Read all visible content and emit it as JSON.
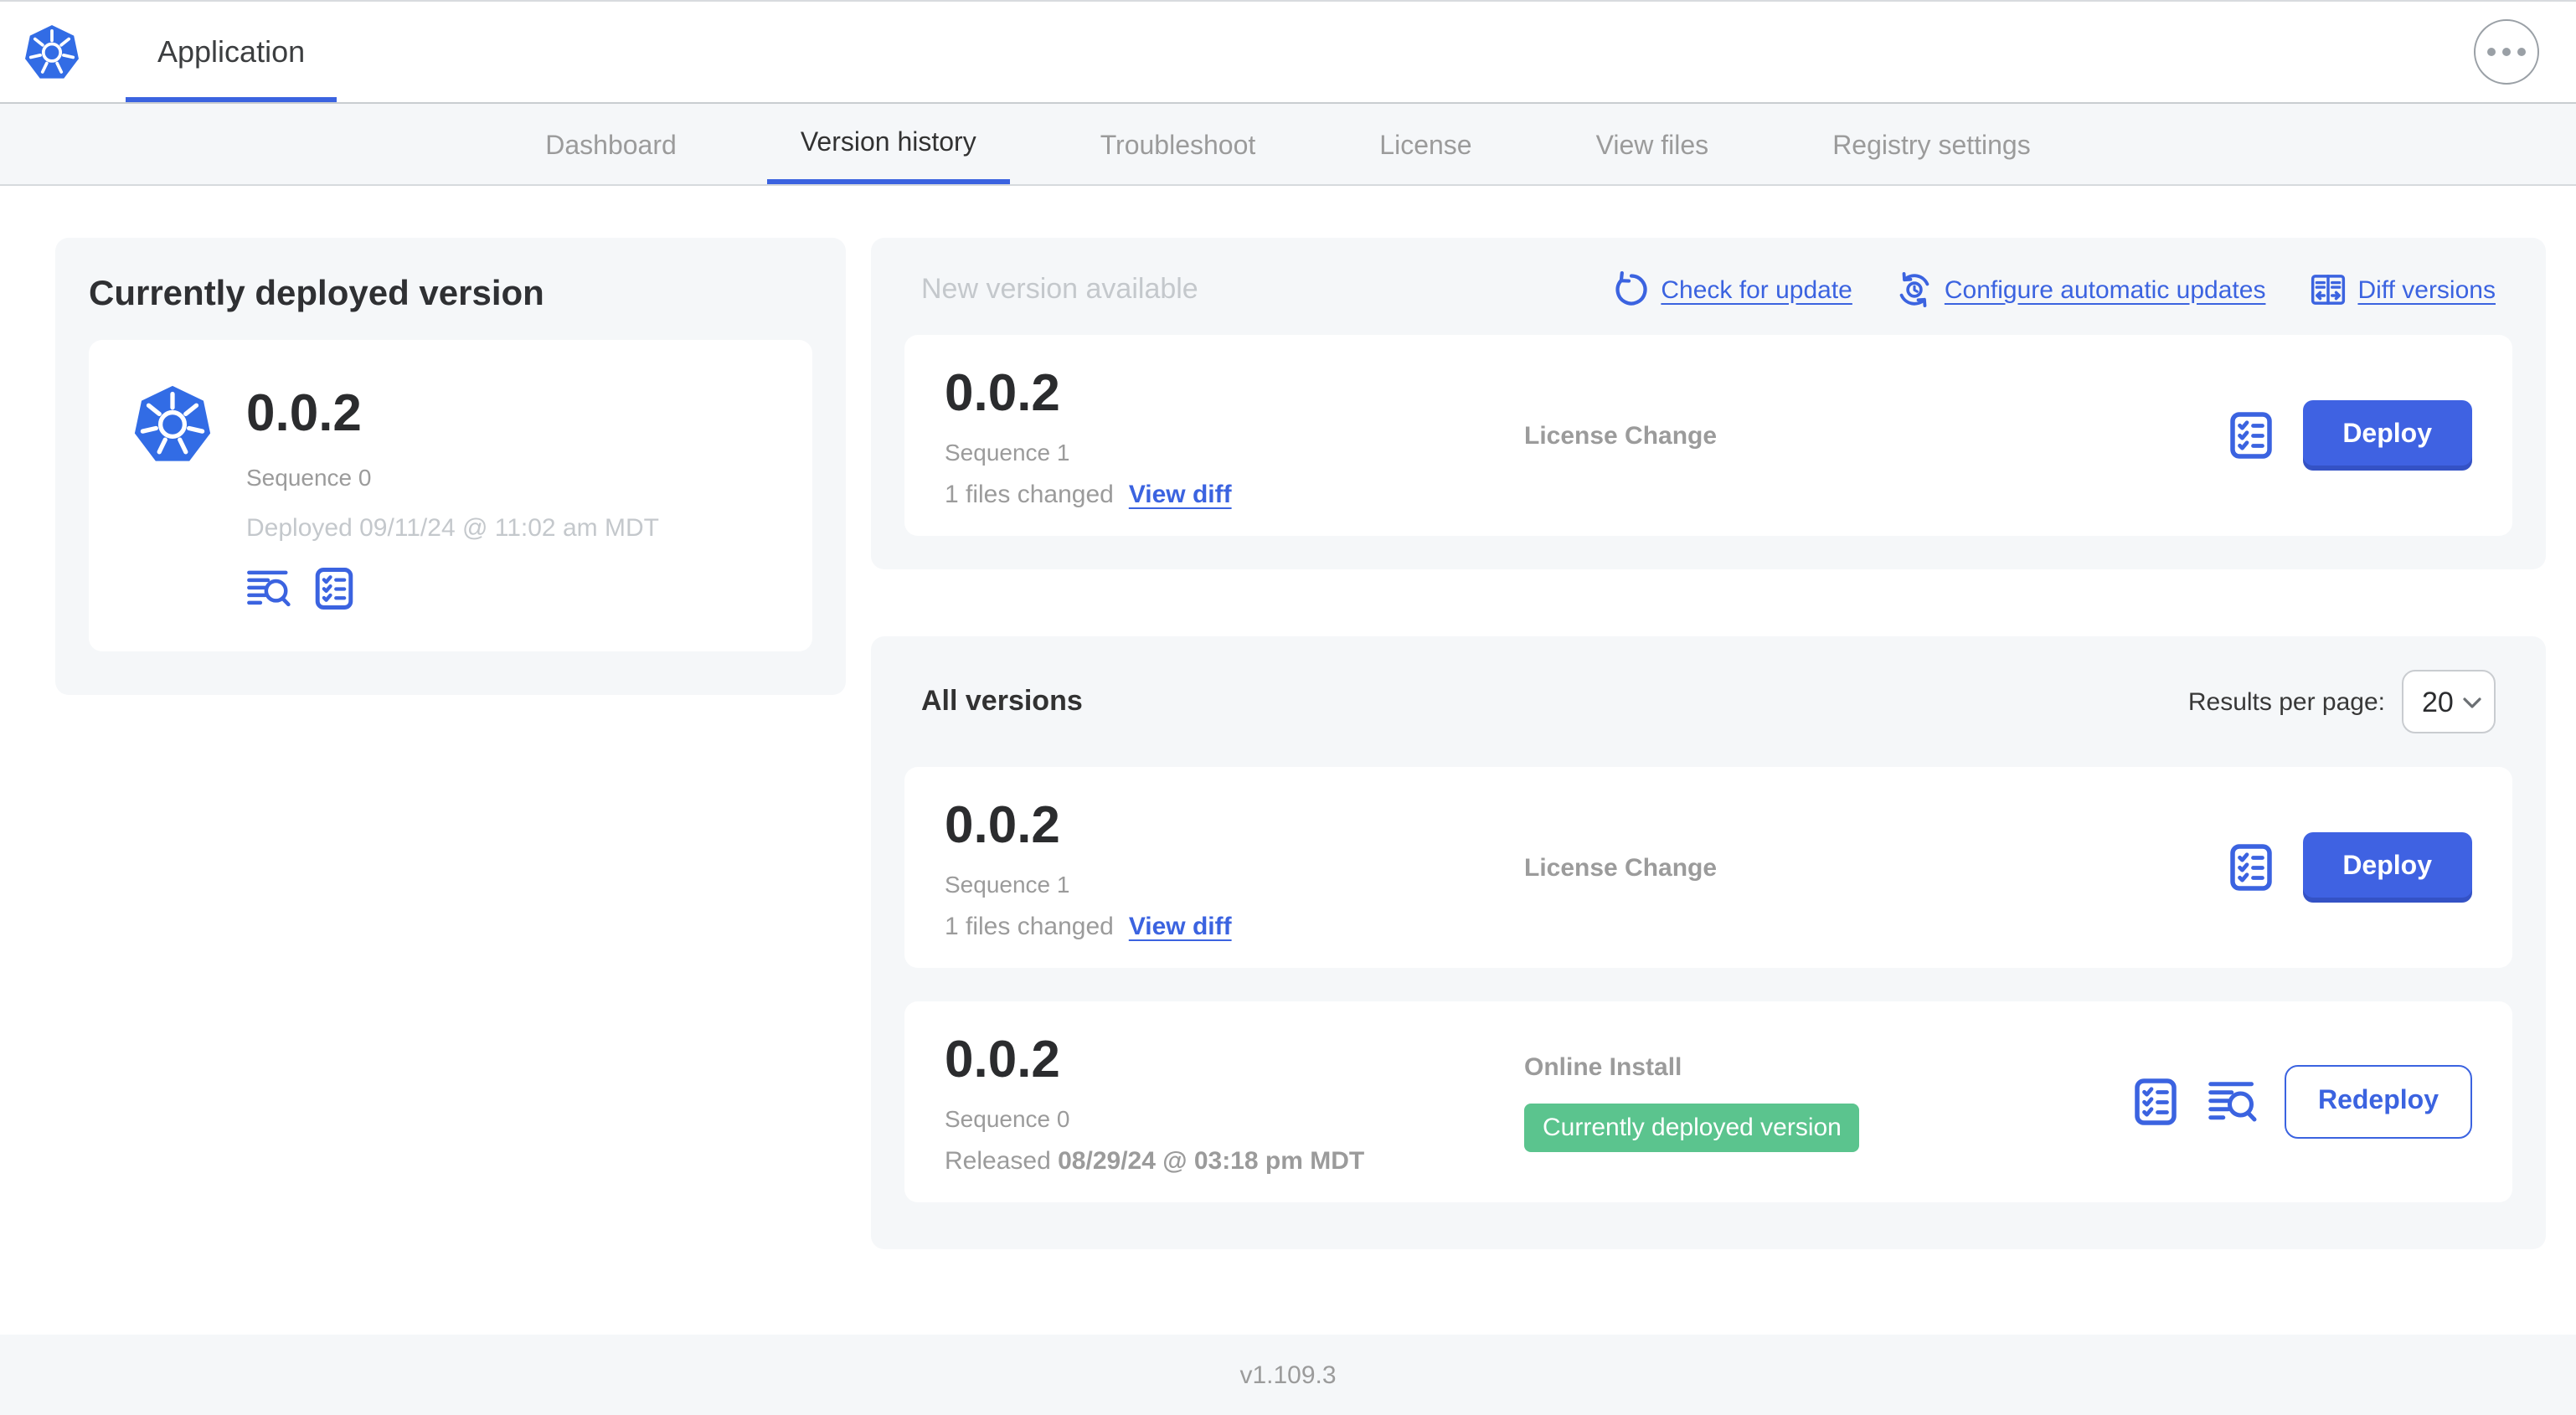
{
  "header": {
    "app_title": "Application"
  },
  "nav": {
    "tabs": [
      {
        "label": "Dashboard",
        "active": false
      },
      {
        "label": "Version history",
        "active": true
      },
      {
        "label": "Troubleshoot",
        "active": false
      },
      {
        "label": "License",
        "active": false
      },
      {
        "label": "View files",
        "active": false
      },
      {
        "label": "Registry settings",
        "active": false
      }
    ]
  },
  "current_version": {
    "title": "Currently deployed version",
    "version": "0.0.2",
    "sequence": "Sequence 0",
    "deployed": "Deployed 09/11/24 @ 11:02 am MDT"
  },
  "new_version": {
    "title": "New version available",
    "check_for_update": "Check for update",
    "configure_updates": "Configure automatic updates",
    "diff_versions": "Diff versions",
    "card": {
      "version": "0.0.2",
      "sequence": "Sequence 1",
      "files_changed": "1 files changed",
      "view_diff": "View diff",
      "source": "License Change",
      "deploy_label": "Deploy"
    }
  },
  "all_versions": {
    "title": "All versions",
    "results_per_page_label": "Results per page:",
    "results_per_page_value": "20",
    "rows": [
      {
        "version": "0.0.2",
        "sequence": "Sequence 1",
        "files_changed": "1 files changed",
        "view_diff": "View diff",
        "source": "License Change",
        "action_label": "Deploy"
      },
      {
        "version": "0.0.2",
        "sequence": "Sequence 0",
        "released_prefix": "Released",
        "released_date": "08/29/24 @ 03:18 pm MDT",
        "source": "Online Install",
        "badge": "Currently deployed version",
        "action_label": "Redeploy"
      }
    ]
  },
  "footer": {
    "app_version": "v1.109.3"
  },
  "colors": {
    "accent_blue": "#3b63e0",
    "logo_blue": "#326ce5",
    "badge_green": "#5bc48e",
    "heading_text": "#323232",
    "muted_text": "#9b9b9b",
    "faint_text": "#c4c8cc",
    "panel_bg": "#f5f7f9"
  },
  "icons": {
    "app_logo": "kubernetes-logo",
    "more_menu": "ellipsis-icon",
    "check_for_update": "refresh-icon",
    "configure_updates": "clock-sync-icon",
    "diff_versions": "diff-panels-icon",
    "view_logs": "logs-icon",
    "preflight_checks": "checklist-icon",
    "select_chevron": "chevron-down-icon"
  }
}
